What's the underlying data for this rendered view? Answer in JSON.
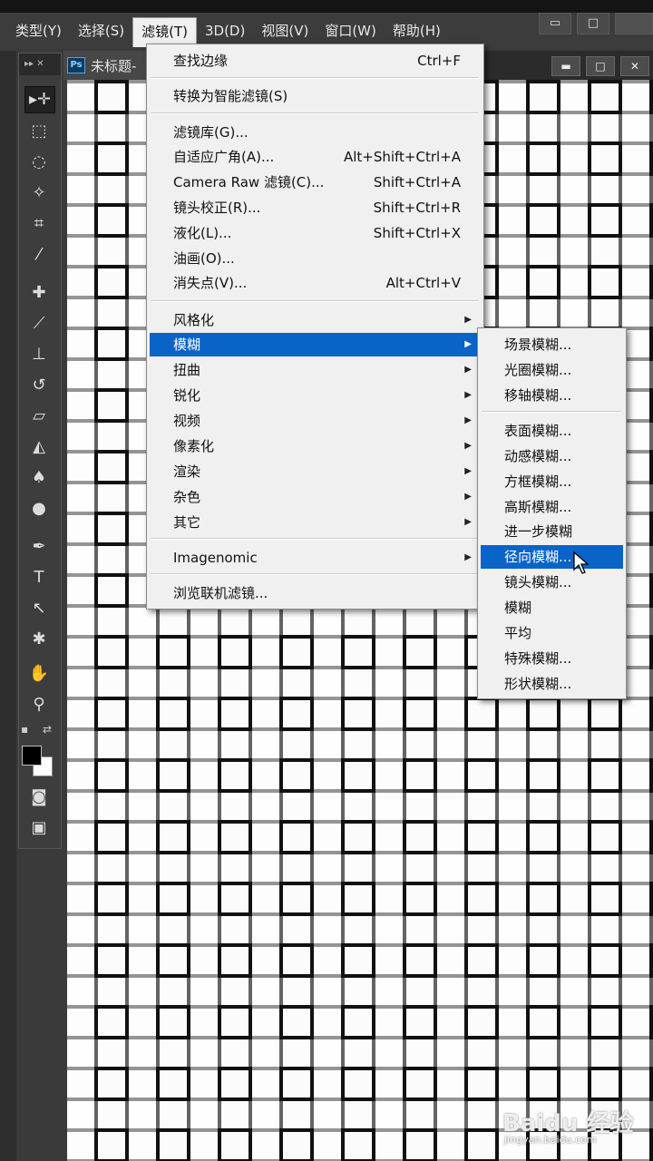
{
  "menubar": {
    "items": [
      {
        "label": "类型(Y)"
      },
      {
        "label": "选择(S)"
      },
      {
        "label": "滤镜(T)"
      },
      {
        "label": "3D(D)"
      },
      {
        "label": "视图(V)"
      },
      {
        "label": "窗口(W)"
      },
      {
        "label": "帮助(H)"
      }
    ],
    "window_controls": {
      "minimize": "▭",
      "restore": "□",
      "close": ""
    }
  },
  "document": {
    "app_icon": "Ps",
    "tab_title": "未标题-",
    "controls": {
      "minimize": "▬",
      "restore": "□",
      "close": "✕"
    }
  },
  "toolbox": {
    "header": "▸▸  ✕",
    "tools": [
      {
        "icon": "move-icon",
        "glyph": "▸✛"
      },
      {
        "icon": "marquee-icon",
        "glyph": "⬚"
      },
      {
        "icon": "lasso-icon",
        "glyph": "◌"
      },
      {
        "icon": "magic-wand-icon",
        "glyph": "✧"
      },
      {
        "icon": "crop-icon",
        "glyph": "⌗"
      },
      {
        "icon": "eyedropper-icon",
        "glyph": "⁄"
      },
      {
        "icon": "healing-brush-icon",
        "glyph": "✚"
      },
      {
        "icon": "brush-icon",
        "glyph": "⟋"
      },
      {
        "icon": "stamp-icon",
        "glyph": "⊥"
      },
      {
        "icon": "history-brush-icon",
        "glyph": "↺"
      },
      {
        "icon": "eraser-icon",
        "glyph": "▱"
      },
      {
        "icon": "paint-bucket-icon",
        "glyph": "◭"
      },
      {
        "icon": "blur-icon",
        "glyph": "♠"
      },
      {
        "icon": "dodge-icon",
        "glyph": "●"
      },
      {
        "icon": "pen-icon",
        "glyph": "✒"
      },
      {
        "icon": "type-icon",
        "glyph": "T"
      },
      {
        "icon": "path-selection-icon",
        "glyph": "↖"
      },
      {
        "icon": "custom-shape-icon",
        "glyph": "✱"
      },
      {
        "icon": "hand-icon",
        "glyph": "✋"
      },
      {
        "icon": "zoom-icon",
        "glyph": "⚲"
      },
      {
        "icon": "quick-mask-icon",
        "glyph": "◙"
      },
      {
        "icon": "screen-mode-icon",
        "glyph": "▣"
      }
    ]
  },
  "filter_menu": {
    "items": [
      {
        "label": "查找边缘",
        "shortcut": "Ctrl+F"
      },
      {
        "label": "转换为智能滤镜(S)",
        "shortcut": ""
      },
      {
        "label": "滤镜库(G)...",
        "shortcut": ""
      },
      {
        "label": "自适应广角(A)...",
        "shortcut": "Alt+Shift+Ctrl+A"
      },
      {
        "label": "Camera Raw 滤镜(C)...",
        "shortcut": "Shift+Ctrl+A"
      },
      {
        "label": "镜头校正(R)...",
        "shortcut": "Shift+Ctrl+R"
      },
      {
        "label": "液化(L)...",
        "shortcut": "Shift+Ctrl+X"
      },
      {
        "label": "油画(O)...",
        "shortcut": ""
      },
      {
        "label": "消失点(V)...",
        "shortcut": "Alt+Ctrl+V"
      },
      {
        "label": "风格化",
        "submenu": true
      },
      {
        "label": "模糊",
        "submenu": true,
        "highlighted": true
      },
      {
        "label": "扭曲",
        "submenu": true
      },
      {
        "label": "锐化",
        "submenu": true
      },
      {
        "label": "视频",
        "submenu": true
      },
      {
        "label": "像素化",
        "submenu": true
      },
      {
        "label": "渲染",
        "submenu": true
      },
      {
        "label": "杂色",
        "submenu": true
      },
      {
        "label": "其它",
        "submenu": true
      },
      {
        "label": "Imagenomic",
        "submenu": true
      },
      {
        "label": "浏览联机滤镜...",
        "shortcut": ""
      }
    ]
  },
  "blur_submenu": {
    "items": [
      {
        "label": "场景模糊..."
      },
      {
        "label": "光圈模糊..."
      },
      {
        "label": "移轴模糊..."
      },
      {
        "label": "表面模糊..."
      },
      {
        "label": "动感模糊..."
      },
      {
        "label": "方框模糊..."
      },
      {
        "label": "高斯模糊..."
      },
      {
        "label": "进一步模糊"
      },
      {
        "label": "径向模糊...",
        "highlighted": true
      },
      {
        "label": "镜头模糊..."
      },
      {
        "label": "模糊"
      },
      {
        "label": "平均"
      },
      {
        "label": "特殊模糊..."
      },
      {
        "label": "形状模糊..."
      }
    ]
  },
  "watermark": {
    "text": "Baidu 经验",
    "sub": "jingyan.baidu.com"
  },
  "colors": {
    "accent": "#0a64c8",
    "menu_bg": "#f0f0f0",
    "ui_bg": "#3c3c3c"
  }
}
